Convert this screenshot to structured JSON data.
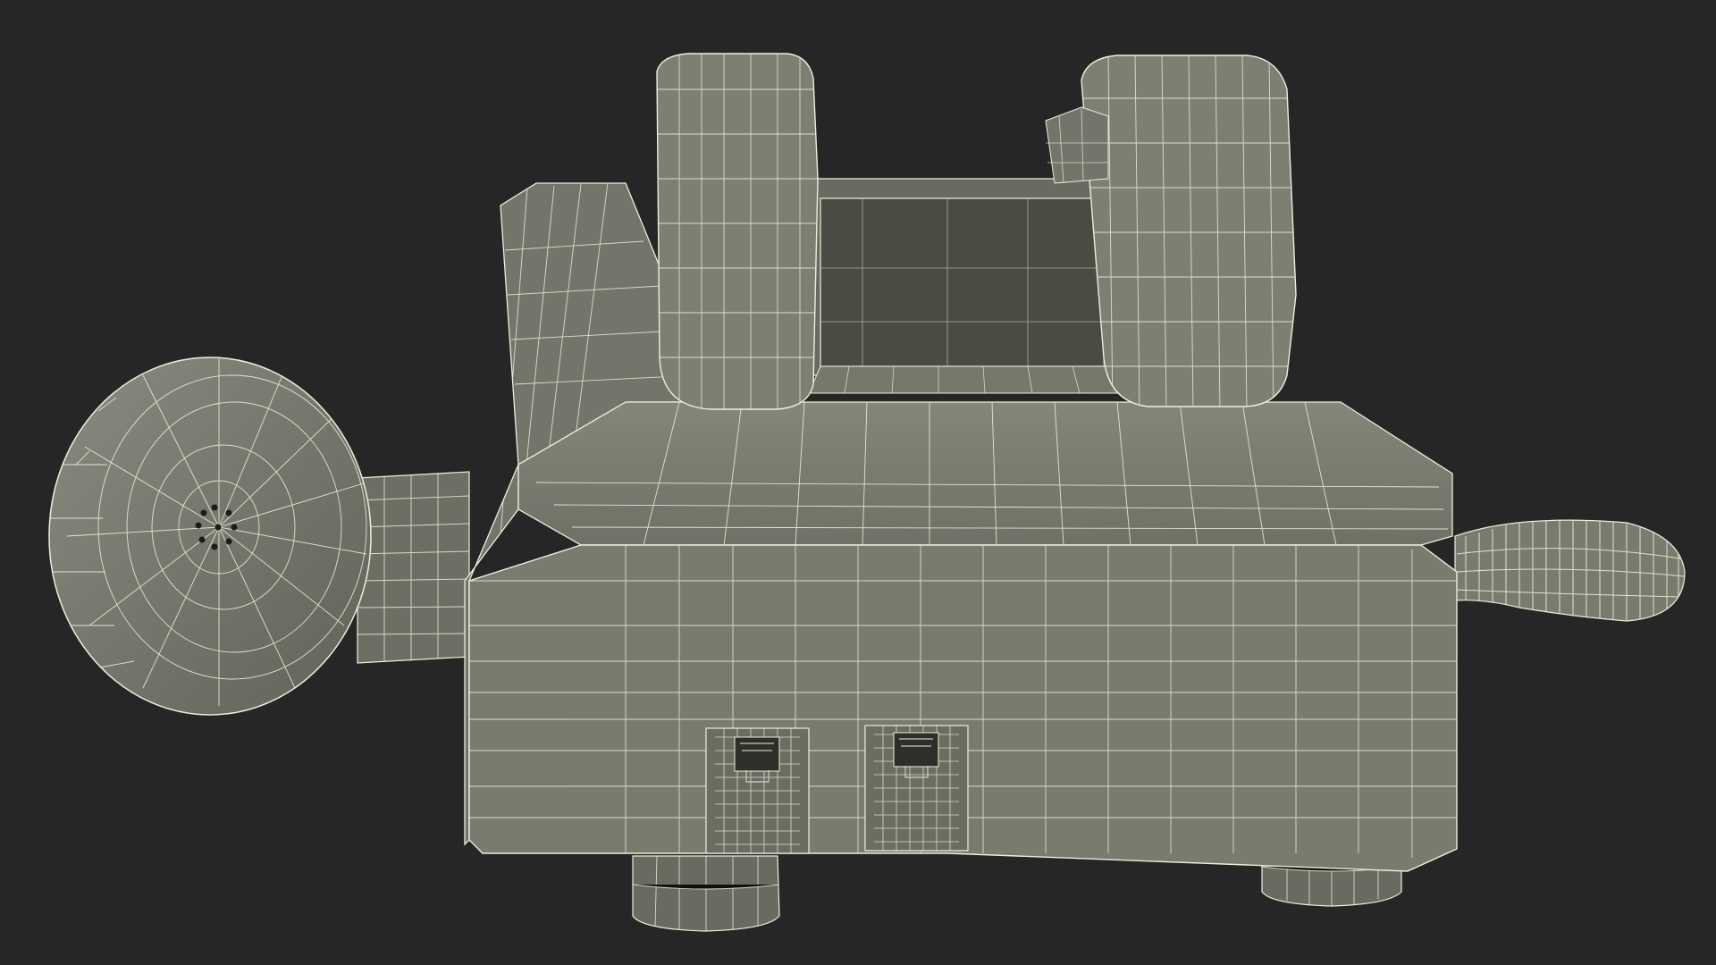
{
  "scene": {
    "subject": "rotary-telephone-wireframe-render",
    "view": "rear",
    "colors": {
      "background": "#262626",
      "shell": "#7c7c70",
      "shell_light": "#86867a",
      "shell_dark": "#64645a",
      "cavity": "#4a4c44",
      "wire": "#eeeedc",
      "port": "#2e2e2a"
    },
    "parts": [
      {
        "id": "body",
        "icon": "phone-body-shape"
      },
      {
        "id": "cradle-left",
        "icon": "cradle-prong-shape"
      },
      {
        "id": "cradle-right",
        "icon": "cradle-prong-shape"
      },
      {
        "id": "handset-earpiece",
        "icon": "earpiece-cone-shape"
      },
      {
        "id": "coiled-cord",
        "icon": "coiled-cord-shape"
      },
      {
        "id": "phone-jack-left",
        "icon": "rj11-port-icon"
      },
      {
        "id": "phone-jack-right",
        "icon": "rj11-port-icon"
      },
      {
        "id": "foot-left",
        "icon": "foot-shape"
      },
      {
        "id": "foot-right",
        "icon": "foot-shape"
      }
    ]
  }
}
